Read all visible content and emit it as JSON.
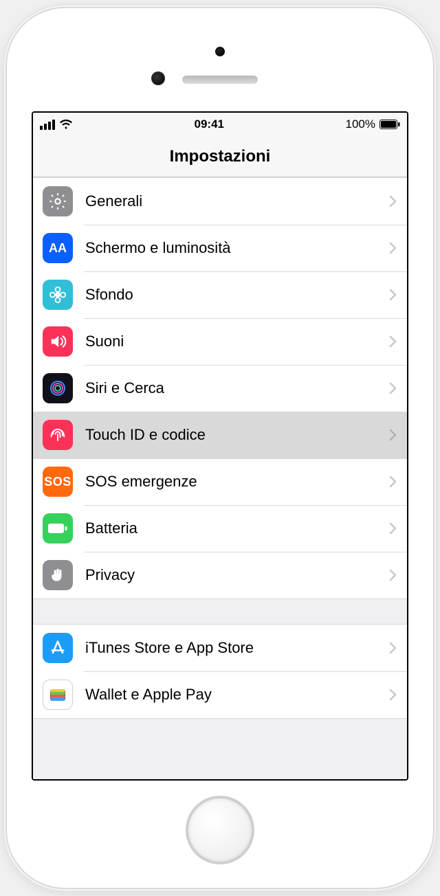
{
  "statusbar": {
    "time": "09:41",
    "battery_percent": "100%"
  },
  "header": {
    "title": "Impostazioni"
  },
  "groups": [
    {
      "rows": [
        {
          "id": "general",
          "icon": "gear-icon",
          "label": "Generali",
          "selected": false
        },
        {
          "id": "display",
          "icon": "display-icon",
          "label": "Schermo e luminosità",
          "selected": false
        },
        {
          "id": "wallpaper",
          "icon": "flower-icon",
          "label": "Sfondo",
          "selected": false
        },
        {
          "id": "sounds",
          "icon": "speaker-icon",
          "label": "Suoni",
          "selected": false
        },
        {
          "id": "siri",
          "icon": "siri-icon",
          "label": "Siri e Cerca",
          "selected": false
        },
        {
          "id": "touchid",
          "icon": "fingerprint-icon",
          "label": "Touch ID e codice",
          "selected": true
        },
        {
          "id": "sos",
          "icon": "sos-icon",
          "label": "SOS emergenze",
          "selected": false,
          "icon_text": "SOS"
        },
        {
          "id": "battery",
          "icon": "battery-icon",
          "label": "Batteria",
          "selected": false
        },
        {
          "id": "privacy",
          "icon": "hand-icon",
          "label": "Privacy",
          "selected": false
        }
      ]
    },
    {
      "rows": [
        {
          "id": "appstore",
          "icon": "appstore-icon",
          "label": "iTunes Store e App Store",
          "selected": false
        },
        {
          "id": "wallet",
          "icon": "wallet-icon",
          "label": "Wallet e Apple Pay",
          "selected": false
        }
      ]
    }
  ]
}
